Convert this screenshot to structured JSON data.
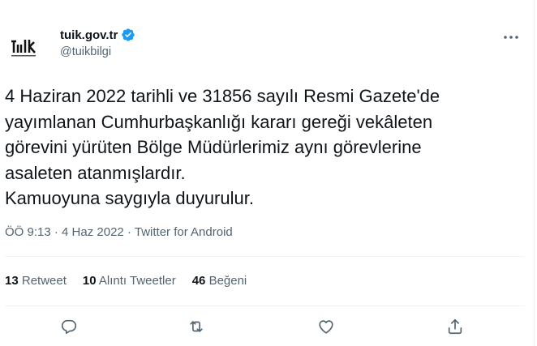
{
  "user": {
    "display_name": "tuik.gov.tr",
    "handle": "@tuikbilgi",
    "logo_text": "TÜİK"
  },
  "tweet": {
    "text": "4 Haziran 2022 tarihli ve 31856 sayılı Resmi Gazete'de\nyayımlanan Cumhurbaşkanlığı kararı gereği vekâleten\ngörevini yürüten Bölge Müdürlerimiz aynı görevlerine\nasaleten atanmışlardır.\nKamuoyuna saygıyla duyurulur.",
    "time": "ÖÖ 9:13",
    "date": "4 Haz 2022",
    "source": "Twitter for Android",
    "separator": "·"
  },
  "stats": {
    "retweets_count": "13",
    "retweets_label": "Retweet",
    "quotes_count": "10",
    "quotes_label": "Alıntı Tweetler",
    "likes_count": "46",
    "likes_label": "Beğeni"
  },
  "icons": {
    "verified": "verified-badge-icon",
    "more": "more-dots-icon",
    "reply": "reply-icon",
    "retweet": "retweet-icon",
    "like": "heart-icon",
    "share": "share-icon"
  },
  "colors": {
    "text": "#0f1419",
    "secondary": "#536471",
    "verified": "#1d9bf0",
    "border": "#eff3f4"
  }
}
